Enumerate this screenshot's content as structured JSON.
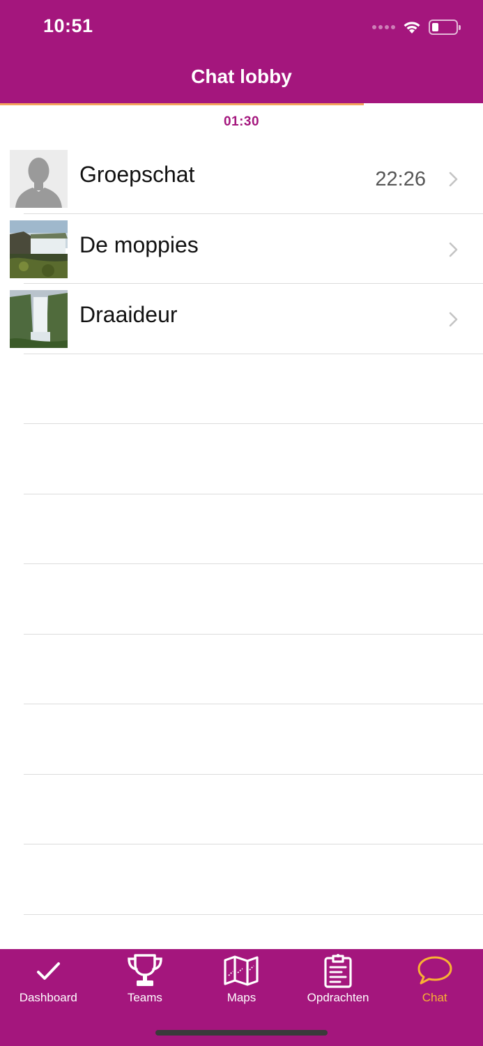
{
  "status_bar": {
    "time": "10:51"
  },
  "header": {
    "title": "Chat lobby"
  },
  "progress": {
    "fraction": 0.753
  },
  "timer": {
    "value": "01:30"
  },
  "chats": [
    {
      "name": "Groepschat",
      "time": "22:26",
      "avatar": "person-placeholder"
    },
    {
      "name": "De moppies",
      "time": "",
      "avatar": "waterfall-photo"
    },
    {
      "name": "Draaideur",
      "time": "",
      "avatar": "waterfall-photo"
    }
  ],
  "tabs": [
    {
      "label": "Dashboard",
      "icon": "check-icon",
      "active": false
    },
    {
      "label": "Teams",
      "icon": "trophy-icon",
      "active": false
    },
    {
      "label": "Maps",
      "icon": "map-icon",
      "active": false
    },
    {
      "label": "Opdrachten",
      "icon": "clipboard-icon",
      "active": false
    },
    {
      "label": "Chat",
      "icon": "chat-bubble-icon",
      "active": true
    }
  ],
  "colors": {
    "brand": "#a4167d",
    "accent": "#f9b233",
    "progress": "#f4a45c"
  }
}
